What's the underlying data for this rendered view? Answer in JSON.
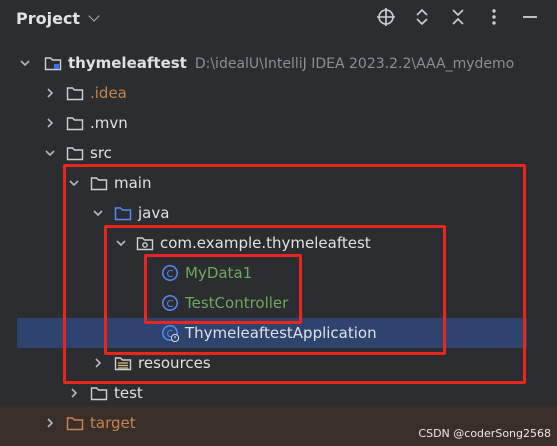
{
  "panel": {
    "title": "Project"
  },
  "toolbar": {
    "icons": [
      "crosshair-icon",
      "expand-all-icon",
      "collapse-all-icon",
      "more-icon",
      "minimize-icon"
    ]
  },
  "tree": {
    "root": {
      "label": "thymeleaftest",
      "path": "D:\\idealU\\IntelliJ IDEA 2023.2.2\\AAA_mydemo"
    },
    "idea": ".idea",
    "mvn": ".mvn",
    "src": "src",
    "main": "main",
    "java": "java",
    "package": "com.example.thymeleaftest",
    "mydata": "MyData1",
    "testcontroller": "TestController",
    "app": "ThymeleaftestApplication",
    "resources": "resources",
    "test": "test",
    "target": "target"
  },
  "colors": {
    "accent_selected": "#2e436e",
    "highlight_box": "#e6261f",
    "new_file_green": "#6fa85c",
    "excluded_orange": "#c4864b"
  },
  "watermark": "CSDN @coderSong2568"
}
